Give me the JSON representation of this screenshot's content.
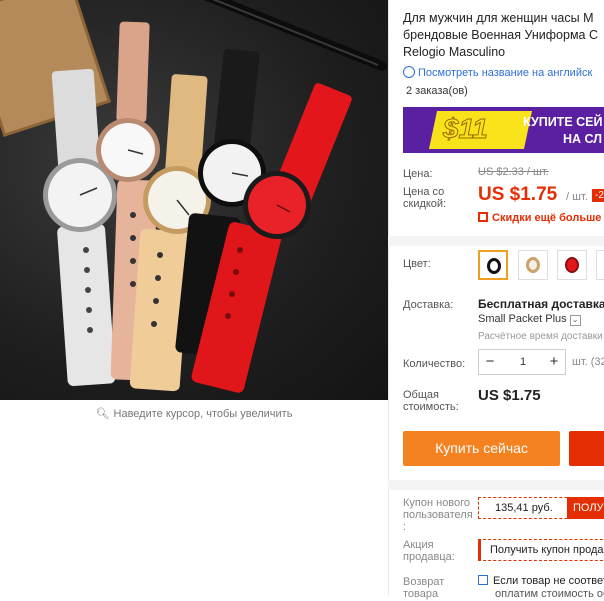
{
  "product": {
    "title_lines": [
      "Для мужчин для женщин часы М",
      "брендовые Военная Униформа С",
      "Relogio Masculino"
    ],
    "translate_link": "Посмотреть название на английск",
    "orders": "2 заказа(ов)",
    "image_hint": "Наведите курсор, чтобы увеличить"
  },
  "banner": {
    "amount": "$11",
    "line1": "КУПИТЕ СЕЙ",
    "line2": "НА СЛ",
    "colors": {
      "bg": "#5b1fa1",
      "accent": "#f8e21a"
    }
  },
  "pricing": {
    "price_label": "Цена:",
    "old_price": "US $2.33 / шт.",
    "discount_label_1": "Цена со",
    "discount_label_2": "скидкой:",
    "price": "US $1.75",
    "per_unit": "/ шт.",
    "discount_badge": "-2",
    "coupon_text": "Скидки ещё больше в",
    "accent_color": "#e62e04"
  },
  "color": {
    "label": "Цвет:",
    "options": [
      {
        "name": "black",
        "selected": true
      },
      {
        "name": "gold",
        "selected": false
      },
      {
        "name": "red",
        "selected": false
      },
      {
        "name": "white",
        "selected": false
      }
    ]
  },
  "shipping": {
    "label": "Доставка:",
    "title": "Бесплатная доставка в",
    "carrier": "Small Packet Plus",
    "estimate": "Расчётное время доставки"
  },
  "quantity": {
    "label": "Количество:",
    "minus": "−",
    "value": "1",
    "plus": "+",
    "unit_text": "шт. (32"
  },
  "total": {
    "label_1": "Общая",
    "label_2": "стоимость:",
    "value": "US $1.75"
  },
  "actions": {
    "buy_now": "Купить сейчас",
    "buy_color": "#f58220"
  },
  "coupons": {
    "new_user_label_1": "Купон нового",
    "new_user_label_2": "пользователя",
    "new_user_label_3": ":",
    "new_user_amount": "135,41 руб.",
    "new_user_button": "ПОЛУЧ",
    "seller_label_1": "Акция",
    "seller_label_2": "продавца:",
    "seller_button": "Получить купон прода"
  },
  "returns": {
    "label_1": "Возврат",
    "label_2": "товара",
    "line_1": "Если товар не соответ",
    "line_2": "оплатим стоимость об"
  }
}
